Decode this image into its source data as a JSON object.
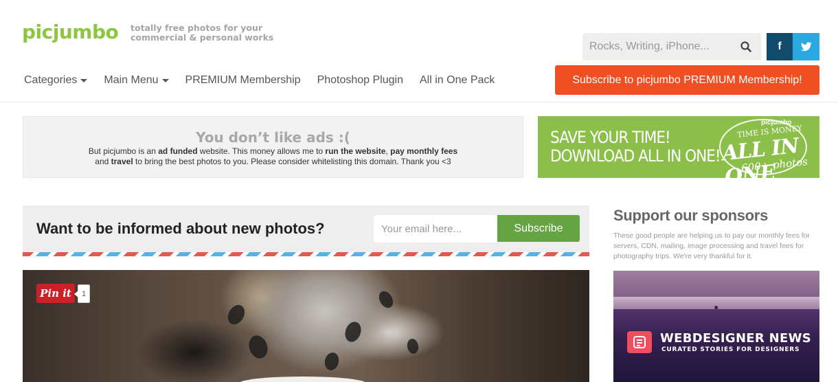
{
  "brand": {
    "logo_text": "picjumbo",
    "tagline_line1": "totally free photos for your",
    "tagline_line2": "commercial & personal works"
  },
  "search": {
    "placeholder": "Rocks, Writing, iPhone...",
    "icon": "search-icon"
  },
  "social": {
    "facebook_label": "f",
    "twitter_icon": "twitter-icon"
  },
  "nav": {
    "items": [
      {
        "label": "Categories",
        "has_dropdown": true
      },
      {
        "label": "Main Menu",
        "has_dropdown": true
      },
      {
        "label": "PREMIUM Membership",
        "has_dropdown": false
      },
      {
        "label": "Photoshop Plugin",
        "has_dropdown": false
      },
      {
        "label": "All in One Pack",
        "has_dropdown": false
      }
    ]
  },
  "premium_button": {
    "label": "Subscribe to picjumbo PREMIUM Membership!",
    "color": "#f04e23"
  },
  "adblock_notice": {
    "title": "You don’t like ads :(",
    "p1_a": "But picjumbo is an ",
    "p1_b": "ad funded",
    "p1_c": " website. This money allows me to ",
    "p1_d": "run the website",
    "p1_e": ", ",
    "p1_f": "pay monthly fees",
    "p2_a": "and ",
    "p2_b": "travel",
    "p2_c": " to bring the best photos to you. Please consider whitelisting this domain. Thank you <3"
  },
  "banner": {
    "line1": "SAVE YOUR TIME!",
    "line2": "DOWNLOAD ALL IN ONE!",
    "brand": "picjumbo",
    "badge_top": "TIME IS MONEY",
    "badge_main": "ALL IN ONE",
    "badge_count": "600+ photos",
    "color": "#8bbf4a"
  },
  "newsletter": {
    "title": "Want to be informed about new photos?",
    "email_placeholder": "Your email here...",
    "button_label": "Subscribe",
    "button_color": "#66a343"
  },
  "pinterest": {
    "label": "Pin it",
    "count": "1"
  },
  "sponsors": {
    "title": "Support our sponsors",
    "text": "These good people are helping us to pay our monthly fees for servers, CDN, mailing, image processing and travel fees for photography trips. We're very thankful for it.",
    "ad_title": "WEBDESIGNER NEWS",
    "ad_subtitle": "CURATED STORIES FOR DESIGNERS"
  },
  "colors": {
    "logo_green": "#8dc63f",
    "facebook": "#124b6b",
    "twitter": "#2aa9e0",
    "pinterest": "#cb2027"
  }
}
